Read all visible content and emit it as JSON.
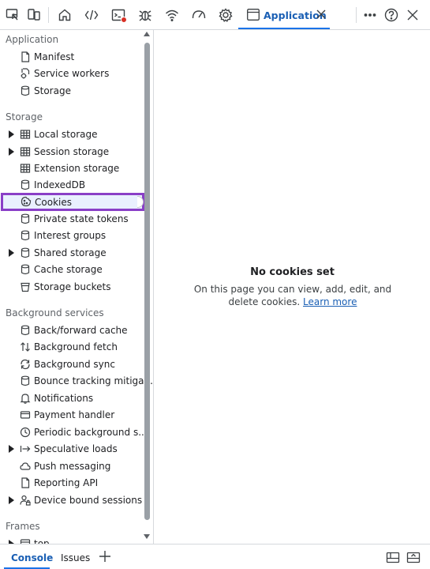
{
  "toolbar": {
    "icons": [
      "inspect-element-icon",
      "device-toolbar-icon",
      "welcome-home-icon",
      "elements-code-icon",
      "console-icon",
      "sources-bug-icon",
      "network-wifi-icon",
      "performance-icon",
      "settings-gear-icon"
    ],
    "active_tab_label": "Application",
    "console_badge_color": "#d93025",
    "accent_color": "#1a73e8"
  },
  "sidebar": {
    "sections": {
      "application": "Application",
      "storage": "Storage",
      "background_services": "Background services",
      "frames": "Frames"
    },
    "application_items": [
      {
        "label": "Manifest",
        "icon": "file-icon"
      },
      {
        "label": "Service workers",
        "icon": "service-worker-icon"
      },
      {
        "label": "Storage",
        "icon": "database-icon"
      }
    ],
    "storage_items": [
      {
        "label": "Local storage",
        "icon": "table-grid-icon",
        "expandable": true
      },
      {
        "label": "Session storage",
        "icon": "table-grid-icon",
        "expandable": true
      },
      {
        "label": "Extension storage",
        "icon": "table-grid-icon",
        "expandable": false
      },
      {
        "label": "IndexedDB",
        "icon": "database-icon",
        "expandable": false
      },
      {
        "label": "Cookies",
        "icon": "cookie-icon",
        "expandable": false,
        "selected": true
      },
      {
        "label": "Private state tokens",
        "icon": "database-icon",
        "expandable": false
      },
      {
        "label": "Interest groups",
        "icon": "database-icon",
        "expandable": false
      },
      {
        "label": "Shared storage",
        "icon": "database-icon",
        "expandable": true
      },
      {
        "label": "Cache storage",
        "icon": "database-icon",
        "expandable": false
      },
      {
        "label": "Storage buckets",
        "icon": "bucket-icon",
        "expandable": false
      }
    ],
    "background_items": [
      {
        "label": "Back/forward cache",
        "icon": "database-icon",
        "expandable": false
      },
      {
        "label": "Background fetch",
        "icon": "up-down-arrows-icon",
        "expandable": false
      },
      {
        "label": "Background sync",
        "icon": "sync-icon",
        "expandable": false
      },
      {
        "label": "Bounce tracking mitiga...",
        "icon": "database-icon",
        "expandable": false
      },
      {
        "label": "Notifications",
        "icon": "bell-icon",
        "expandable": false
      },
      {
        "label": "Payment handler",
        "icon": "credit-card-icon",
        "expandable": false
      },
      {
        "label": "Periodic background s...",
        "icon": "clock-icon",
        "expandable": false
      },
      {
        "label": "Speculative loads",
        "icon": "arrow-to-bar-icon",
        "expandable": true
      },
      {
        "label": "Push messaging",
        "icon": "cloud-icon",
        "expandable": false
      },
      {
        "label": "Reporting API",
        "icon": "file-icon",
        "expandable": false
      },
      {
        "label": "Device bound sessions",
        "icon": "user-lock-icon",
        "expandable": true
      }
    ],
    "frames_items": [
      {
        "label": "top",
        "icon": "frame-icon",
        "expandable": true
      }
    ]
  },
  "main": {
    "title": "No cookies set",
    "description": "On this page you can view, add, edit, and delete cookies.",
    "learn_more": "Learn more"
  },
  "drawer": {
    "tabs": [
      "Console",
      "Issues"
    ],
    "active_tab": "Console"
  }
}
